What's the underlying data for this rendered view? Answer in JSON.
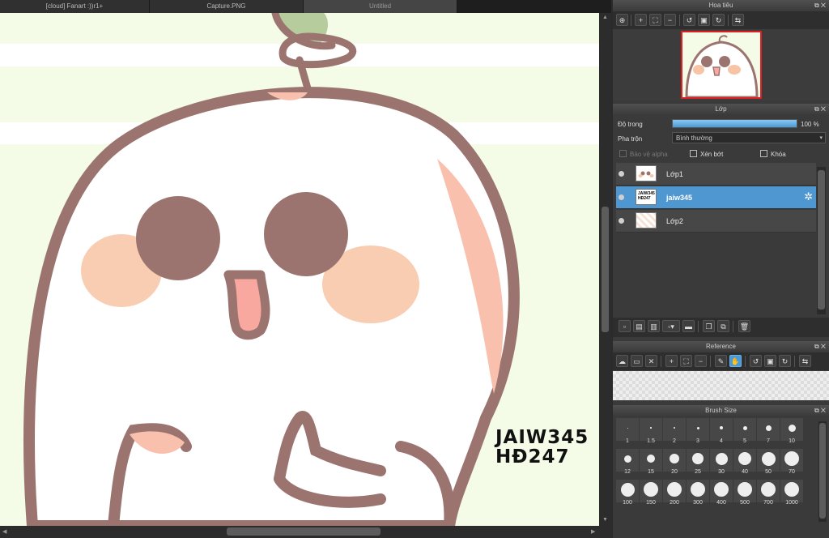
{
  "tabs": [
    {
      "label": "[cloud] Fanart :))r1+"
    },
    {
      "label": "Capture.PNG"
    },
    {
      "label": "Untitled"
    }
  ],
  "canvas": {
    "watermark_line1": "JAIW345",
    "watermark_line2": "HĐ247"
  },
  "navigator": {
    "title": "Hoa tiêu",
    "tools": [
      "zoom-fit-icon",
      "zoom-in-icon",
      "fit-window-icon",
      "zoom-out-icon",
      "rotate-left-icon",
      "actual-size-icon",
      "rotate-right-icon",
      "flip-icon"
    ]
  },
  "layers": {
    "title": "Lớp",
    "opacity_label": "Độ trong",
    "opacity_value": "100 %",
    "opacity_fraction": 1.0,
    "blend_label": "Pha trộn",
    "blend_value": "Bình thường",
    "protect_alpha_label": "Bảo vệ alpha",
    "clipping_label": "Xén bớt",
    "lock_label": "Khóa",
    "items": [
      {
        "name": "Lớp1",
        "selected": false
      },
      {
        "name": "jaiw345",
        "selected": true
      },
      {
        "name": "Lớp2",
        "selected": false
      }
    ],
    "selected_thumb_text": "JAIW345 HĐ247"
  },
  "reference": {
    "title": "Reference"
  },
  "brush_size": {
    "title": "Brush Size",
    "sizes": [
      "1",
      "1.5",
      "2",
      "3",
      "4",
      "5",
      "7",
      "10",
      "12",
      "15",
      "20",
      "25",
      "30",
      "40",
      "50",
      "70",
      "100",
      "150",
      "200",
      "300",
      "400",
      "500",
      "700",
      "1000"
    ]
  },
  "colors": {
    "accent": "#4f97d1",
    "outline": "#9b7470",
    "blush": "#f7c4a5",
    "background": "#f4fbe7"
  }
}
